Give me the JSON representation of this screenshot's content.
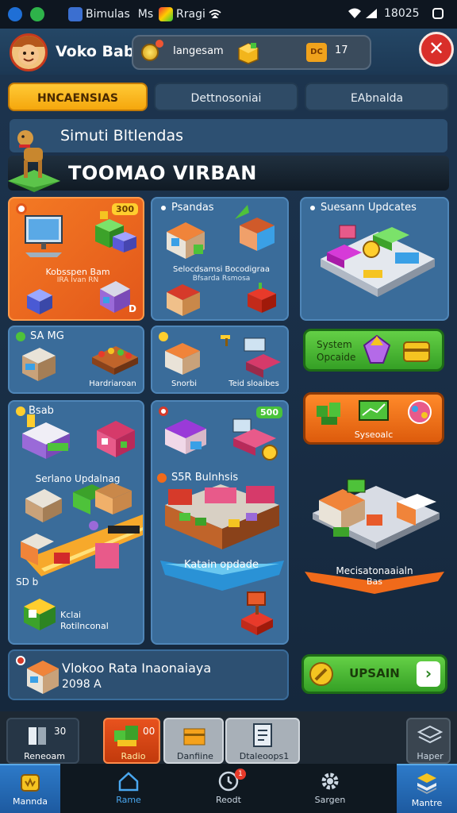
{
  "status": {
    "app1": "Bimulas",
    "app1b": "Ms",
    "app2": "Rragi",
    "time": "18025"
  },
  "header": {
    "player_name": "Voko Babi",
    "resource1_label": "Iangesam",
    "resource2_value": "17",
    "resource2_badge": "DC",
    "close_icon": "close-icon"
  },
  "tabs": [
    {
      "label": "HNCAENSIAS",
      "active": true
    },
    {
      "label": "Dettnosoniai",
      "active": false
    },
    {
      "label": "EAbnalda",
      "active": false
    }
  ],
  "banner": {
    "title": "Simuti Bltlendas",
    "subtitle": "TOOMAO VIRBAN"
  },
  "cards": {
    "c1": {
      "badge": "300",
      "sub": "Kobsspen Bam",
      "sub2": "IRA Ivan RN",
      "corner": "D"
    },
    "c2": {
      "title": "Psandas",
      "sub": "Selocdsamsi Bocodigraa",
      "sub2": "Bfsarda Rsmosa"
    },
    "c3": {
      "title": "Suesann Updcates"
    },
    "c4": {
      "title": "SA MG",
      "sub": "Hardriaroan"
    },
    "c5": {
      "sub": "Snorbi",
      "sub2": "Teid sloaibes"
    },
    "c6": {
      "title": "System",
      "title2": "Opcaide"
    },
    "c7": {
      "title": "Syseoalc"
    },
    "c8": {
      "title": "Bsab",
      "sub": "Serlano Updalnag",
      "label1": "SD b",
      "label2": "Kclai",
      "label3": "Rotilnconal"
    },
    "c9": {
      "badge": "500",
      "title": "S5R Bulnhsis",
      "sub": "Katain opdade"
    },
    "c10": {
      "title": "Mecisatonaaialn",
      "title2": "Bas"
    },
    "c11": {
      "title": "Vlokoo Rata Inaonaiaya",
      "sub": "2098 A"
    },
    "upgrade_button": "UPSAIN"
  },
  "actionbar": {
    "a1_label": "Reneoam",
    "a1_count": "30",
    "a2_label": "Radio",
    "a2_count": "00",
    "a3_label": "Danfiine",
    "a4_label": "Dtaleoops1",
    "a5_label": "Haper"
  },
  "nav": [
    {
      "label": "Mannda",
      "icon": "crown-icon"
    },
    {
      "label": "Rame",
      "icon": "home-icon"
    },
    {
      "label": "Reodt",
      "icon": "clock-icon",
      "badge": "1"
    },
    {
      "label": "Sargen",
      "icon": "gear-icon"
    },
    {
      "label": "Mantre",
      "icon": "stack-icon"
    }
  ],
  "colors": {
    "accent_orange": "#f06a1a",
    "accent_green": "#49c33b",
    "panel_blue": "#3a6c9a",
    "tab_active": "#ffb619"
  }
}
